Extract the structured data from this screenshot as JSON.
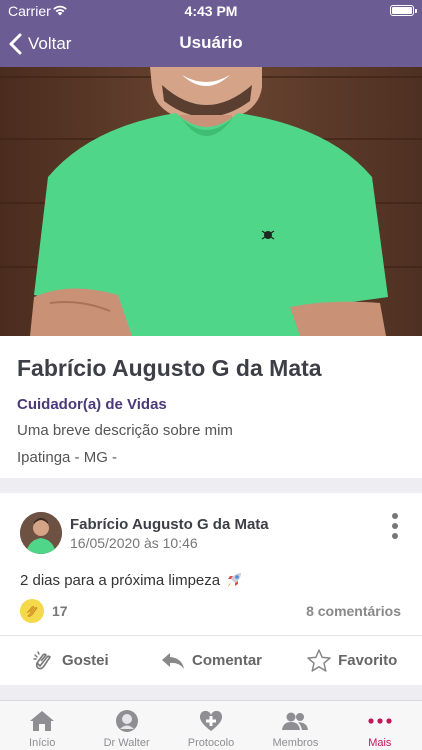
{
  "status_bar": {
    "carrier": "Carrier",
    "time": "4:43 PM"
  },
  "nav": {
    "back_label": "Voltar",
    "title": "Usuário"
  },
  "profile": {
    "name": "Fabrício Augusto G da Mata",
    "role": "Cuidador(a) de Vidas",
    "description": "Uma breve descrição sobre mim",
    "location": "Ipatinga - MG -"
  },
  "post": {
    "author": "Fabrício Augusto G da Mata",
    "date": "16/05/2020 às 10:46",
    "text": "2 dias para a próxima limpeza",
    "reaction_count": "17",
    "comments": "8 comentários",
    "actions": {
      "like": "Gostei",
      "comment": "Comentar",
      "favorite": "Favorito"
    }
  },
  "tabs": [
    {
      "label": "Início",
      "icon": "home-icon"
    },
    {
      "label": "Dr Walter",
      "icon": "doctor-avatar-icon"
    },
    {
      "label": "Protocolo",
      "icon": "heart-plus-icon"
    },
    {
      "label": "Membros",
      "icon": "members-icon"
    },
    {
      "label": "Mais",
      "icon": "more-dots-icon"
    }
  ],
  "colors": {
    "header": "#6b5c93",
    "role": "#4a3a7a",
    "active_tab": "#c2185b",
    "shirt": "#4fd688"
  }
}
